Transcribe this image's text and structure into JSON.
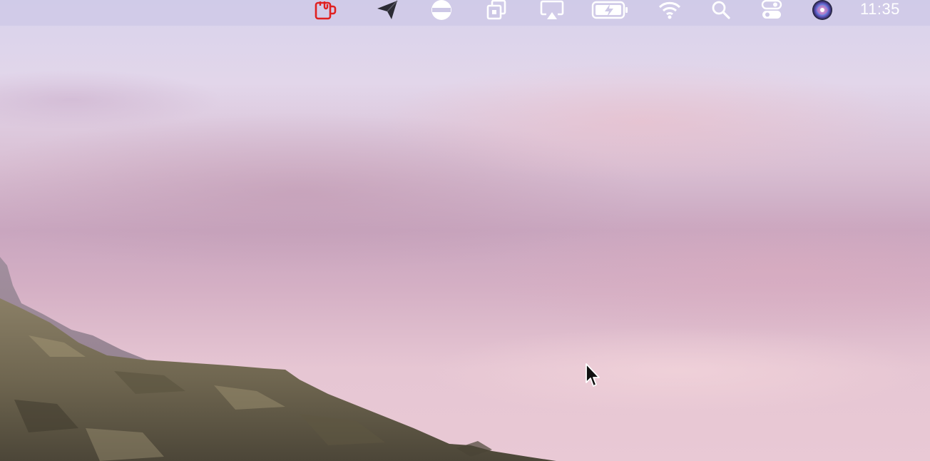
{
  "menubar": {
    "icons": [
      "coffee-mug-icon",
      "paper-plane-icon",
      "do-not-disturb-icon",
      "window-stack-icon",
      "airplay-icon",
      "battery-icon",
      "wifi-icon",
      "spotlight-search-icon",
      "control-center-icon",
      "siri-icon"
    ],
    "clock": "11:35"
  },
  "colors": {
    "menubar_bg": "#cdc8e6",
    "mug_red": "#e02020",
    "sky_top": "#d8d3ec",
    "sky_pink": "#d9bfd3"
  }
}
